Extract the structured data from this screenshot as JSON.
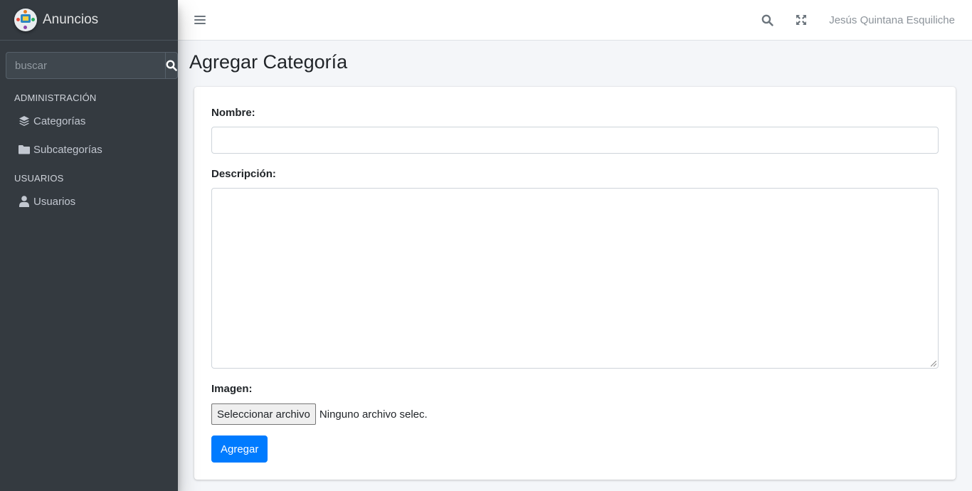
{
  "brand": {
    "name": "Anuncios",
    "logo": "app-logo"
  },
  "sidebar": {
    "search": {
      "placeholder": "buscar",
      "value": "",
      "button_icon": "search-icon"
    },
    "sections": [
      {
        "header": "ADMINISTRACIÓN",
        "items": [
          {
            "label": "Categorías",
            "icon": "layers-icon"
          },
          {
            "label": "Subcategorías",
            "icon": "folder-icon"
          }
        ]
      },
      {
        "header": "USUARIOS",
        "items": [
          {
            "label": "Usuarios",
            "icon": "user-icon"
          }
        ]
      }
    ]
  },
  "topbar": {
    "menu_icon": "hamburger-icon",
    "search_icon": "search-icon",
    "fullscreen_icon": "expand-icon",
    "user_name": "Jesús Quintana Esquiliche"
  },
  "page": {
    "title": "Agregar Categoría"
  },
  "form": {
    "nombre_label": "Nombre:",
    "nombre_value": "",
    "descripcion_label": "Descripción:",
    "descripcion_value": "",
    "imagen_label": "Imagen:",
    "file_button": "Seleccionar archivo",
    "file_status": "Ninguno archivo selec.",
    "submit_label": "Agregar"
  },
  "colors": {
    "sidebar_bg": "#343a40",
    "content_bg": "#f4f6f9",
    "primary": "#007bff"
  }
}
